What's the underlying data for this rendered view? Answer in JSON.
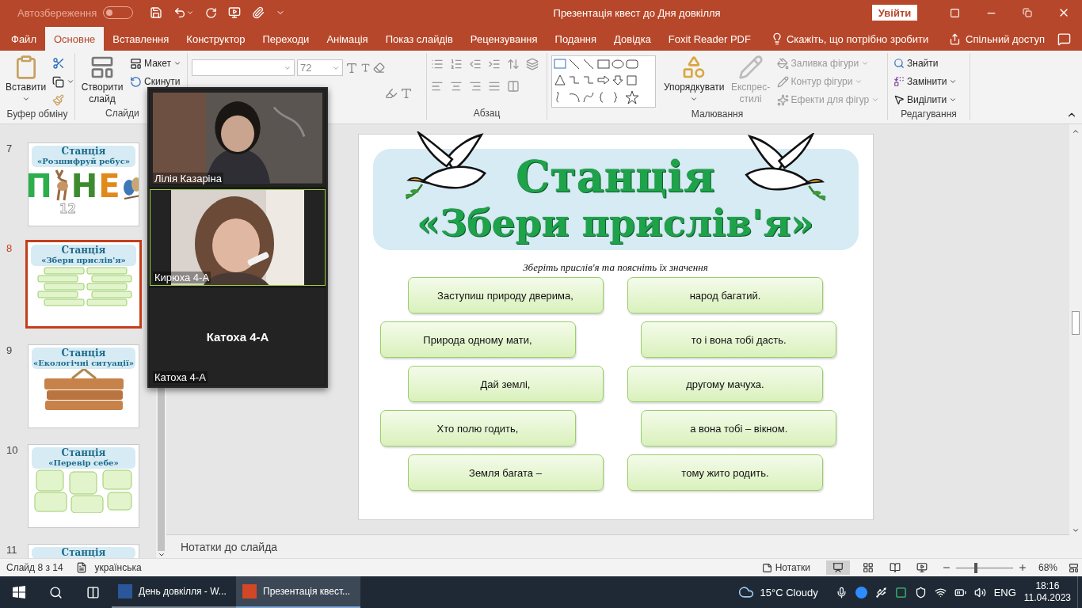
{
  "title_bar": {
    "autosave_label": "Автозбереження",
    "autosave_on": false,
    "title": "Презентація квест до Дня довкілля",
    "sign_in": "Увійти"
  },
  "tabs": [
    {
      "label": "Файл",
      "selected": false
    },
    {
      "label": "Основне",
      "selected": true
    },
    {
      "label": "Вставлення",
      "selected": false
    },
    {
      "label": "Конструктор",
      "selected": false
    },
    {
      "label": "Переходи",
      "selected": false
    },
    {
      "label": "Анімація",
      "selected": false
    },
    {
      "label": "Показ слайдів",
      "selected": false
    },
    {
      "label": "Рецензування",
      "selected": false
    },
    {
      "label": "Подання",
      "selected": false
    },
    {
      "label": "Довідка",
      "selected": false
    },
    {
      "label": "Foxit Reader PDF",
      "selected": false
    }
  ],
  "tell_me": "Скажіть, що потрібно зробити",
  "share": "Спільний доступ",
  "ribbon": {
    "clipboard": {
      "paste": "Вставити",
      "label": "Буфер обміну"
    },
    "slides": {
      "new_slide": "Створити слайд",
      "layout": "Макет",
      "reset": "Скинути",
      "label": "Слайди"
    },
    "font": {
      "size": "72"
    },
    "paragraph": {
      "label": "Абзац"
    },
    "drawing": {
      "arrange": "Упорядкувати",
      "quick_styles": "Експрес-стилі",
      "fill": "Заливка фігури",
      "outline": "Контур фігури",
      "effects": "Ефекти для фігур",
      "label": "Малювання"
    },
    "editing": {
      "find": "Знайти",
      "replace": "Замінити",
      "select": "Виділити",
      "label": "Редагування"
    }
  },
  "thumbnails": [
    {
      "number": "7",
      "selected": false,
      "kind": "rebus",
      "title": "Станція",
      "subtitle": "«Розшифруй ребус»",
      "letters": [
        "П",
        "Н",
        "Е"
      ],
      "extra": "12"
    },
    {
      "number": "8",
      "selected": true,
      "kind": "proverbs",
      "title": "Станція",
      "subtitle": "«Збери прислів'я»"
    },
    {
      "number": "9",
      "selected": false,
      "kind": "situations",
      "title": "Станція",
      "subtitle": "«Екологічні ситуації»"
    },
    {
      "number": "10",
      "selected": false,
      "kind": "check",
      "title": "Станція",
      "subtitle": "«Перевір себе»"
    },
    {
      "number": "11",
      "selected": false,
      "kind": "cut",
      "title": "Станція"
    }
  ],
  "video_call": {
    "participants": [
      {
        "name": "Лілія Казаріна",
        "kind": "video",
        "active": false
      },
      {
        "name": "Кирюха 4-А",
        "kind": "video",
        "active": true
      },
      {
        "name": "Катоха 4-А",
        "kind": "avatar",
        "active": false,
        "center_name": "Катоха 4-А"
      }
    ]
  },
  "slide": {
    "title": "Станція",
    "subtitle": "«Збери прислів'я»",
    "instruction": "Зберіть прислів'я та поясніть їх значення",
    "rows": [
      {
        "left": "Заступиш природу дверима,",
        "right": "народ багатий."
      },
      {
        "left": "Природа одному мати,",
        "right": "то і вона тобі дасть."
      },
      {
        "left": "Дай землі,",
        "right": "другому мачуха."
      },
      {
        "left": "Хто полю годить,",
        "right": "а вона тобі – вікном."
      },
      {
        "left": "Земля багата –",
        "right": "тому жито родить."
      }
    ]
  },
  "notes_placeholder": "Нотатки до слайда",
  "status_bar": {
    "slide_info": "Слайд 8 з 14",
    "language": "українська",
    "notes": "Нотатки",
    "zoom": {
      "level": 0.35
    },
    "zoom_reading": "68%"
  },
  "taskbar": {
    "apps": [
      {
        "kind": "word",
        "label": "День довкілля - W...",
        "selected": false
      },
      {
        "kind": "powerpoint",
        "label": "Презентація квест...",
        "selected": true
      }
    ],
    "weather": "15°C  Cloudy",
    "language": "ENG",
    "time": "18:16",
    "date": "11.04.2023"
  }
}
